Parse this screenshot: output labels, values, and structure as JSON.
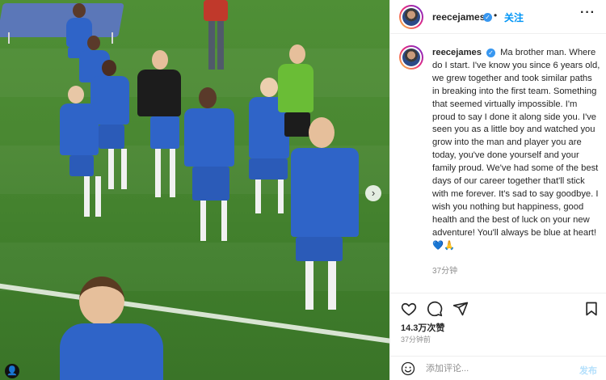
{
  "post": {
    "username": "reecejames",
    "follow_label": "关注",
    "separator": "•",
    "more_label": "···",
    "caption": "Ma brother man. Where do I start. I've know you since 6 years old, we grew together and took similar paths in breaking into the first team. Something that seemed virtually impossible. I'm proud to say I done it along side you. I've seen you as a little boy and watched you grow into the man and player you are today, you've done yourself and your family proud. We've had some of the best days of our career together that'll stick with me forever. It's sad to say goodbye. I wish you nothing but happiness, good health and the best of luck on your new adventure! You'll always be blue at heart!",
    "caption_emoji": "💙",
    "caption_trailing": "🙏",
    "caption_time": "37分钟",
    "likes": "14.3万次赞",
    "post_time": "37分钟前"
  },
  "comment": {
    "placeholder": "添加评论...",
    "post_label": "发布"
  },
  "photo": {
    "next_label": "›",
    "user_tag_label": "👤"
  },
  "icons": {
    "like": "heart-outline-icon",
    "comment": "comment-icon",
    "share": "paper-plane-icon",
    "save": "bookmark-icon",
    "emoji": "smiley-icon",
    "verified": "verified-badge-icon"
  },
  "colors": {
    "accent": "#0095f6",
    "verified": "#3897f0",
    "muted": "#8e8e8e",
    "chelsea_blue": "#2f64c8"
  }
}
